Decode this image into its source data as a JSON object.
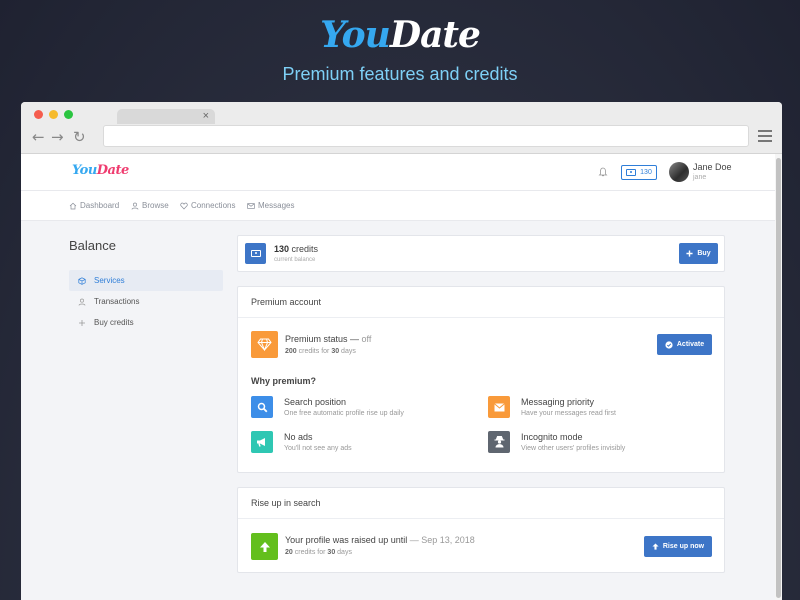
{
  "hero": {
    "logo_you": "You",
    "logo_date": "Date",
    "subtitle": "Premium features and credits"
  },
  "app": {
    "logo_you": "You",
    "logo_date": "Date",
    "credits_badge": "130",
    "user": {
      "name": "Jane Doe",
      "username": "jane"
    }
  },
  "nav": [
    {
      "label": "Dashboard",
      "icon": "home-icon"
    },
    {
      "label": "Browse",
      "icon": "user-icon"
    },
    {
      "label": "Connections",
      "icon": "heart-icon"
    },
    {
      "label": "Messages",
      "icon": "envelope-icon"
    }
  ],
  "sidebar": {
    "title": "Balance",
    "items": [
      {
        "label": "Services",
        "icon": "box-icon",
        "active": true
      },
      {
        "label": "Transactions",
        "icon": "user-icon",
        "active": false
      },
      {
        "label": "Buy credits",
        "icon": "plus-icon",
        "active": false
      }
    ]
  },
  "balance": {
    "amount": "130",
    "unit": "credits",
    "sub": "current balance",
    "buy_label": "Buy"
  },
  "premium": {
    "header": "Premium account",
    "status_label": "Premium status",
    "status_dash": " — ",
    "status_value": "off",
    "cost_amount": "200",
    "cost_mid": " credits for ",
    "cost_days": "30",
    "cost_unit": " days",
    "activate_label": "Activate",
    "why_title": "Why premium?",
    "features": [
      {
        "title": "Search position",
        "desc": "One free automatic profile rise up daily",
        "icon": "search-icon",
        "color": "#3d8ee8"
      },
      {
        "title": "Messaging priority",
        "desc": "Have your messages read first",
        "icon": "envelope-icon",
        "color": "#f99a3a"
      },
      {
        "title": "No ads",
        "desc": "You'll not see any ads",
        "icon": "megaphone-icon",
        "color": "#2ec7b3"
      },
      {
        "title": "Incognito mode",
        "desc": "View other users' profiles invisibly",
        "icon": "spy-icon",
        "color": "#5f6670"
      }
    ]
  },
  "rise": {
    "header": "Rise up in search",
    "text": "Your profile was raised up until",
    "dash": " — ",
    "date": "Sep 13, 2018",
    "cost_amount": "20",
    "cost_mid": " credits for ",
    "cost_days": "30",
    "cost_unit": " days",
    "button_label": "Rise up now"
  },
  "colors": {
    "accent": "#3d75c7",
    "brand_blue": "#35a8f0",
    "brand_pink": "#ef3c6f"
  }
}
